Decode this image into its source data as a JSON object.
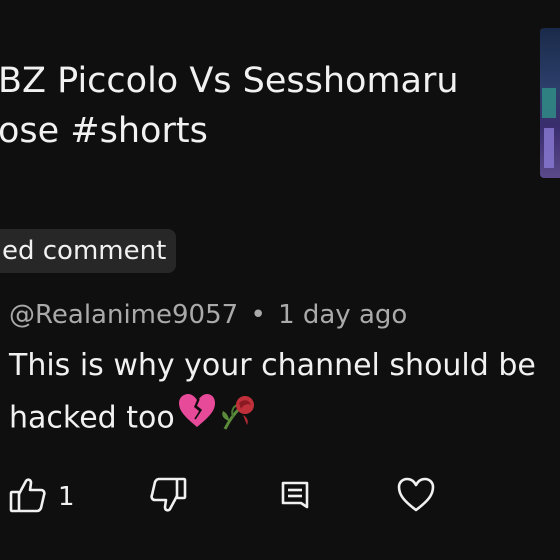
{
  "video": {
    "title_line1": "BZ Piccolo Vs Sesshomaru",
    "title_line2": "ose #shorts"
  },
  "chip": {
    "label": "ed comment"
  },
  "comment": {
    "author": "@Realanime9057",
    "separator": "•",
    "time": "1 day ago",
    "text_line1": "This is why your channel should be",
    "text_line2": "hacked too",
    "emojis": [
      "broken-heart-emoji",
      "wilted-rose-emoji"
    ]
  },
  "actions": {
    "like_count": "1",
    "icons": [
      "thumbs-up-icon",
      "thumbs-down-icon",
      "reply-icon",
      "heart-icon"
    ]
  },
  "colors": {
    "background": "#0f0f0f",
    "text_primary": "#f1f1f1",
    "text_secondary": "#aaaaaa",
    "chip_bg": "#272727",
    "heart_pink": "#e84a9a",
    "rose_red": "#c0303a"
  }
}
